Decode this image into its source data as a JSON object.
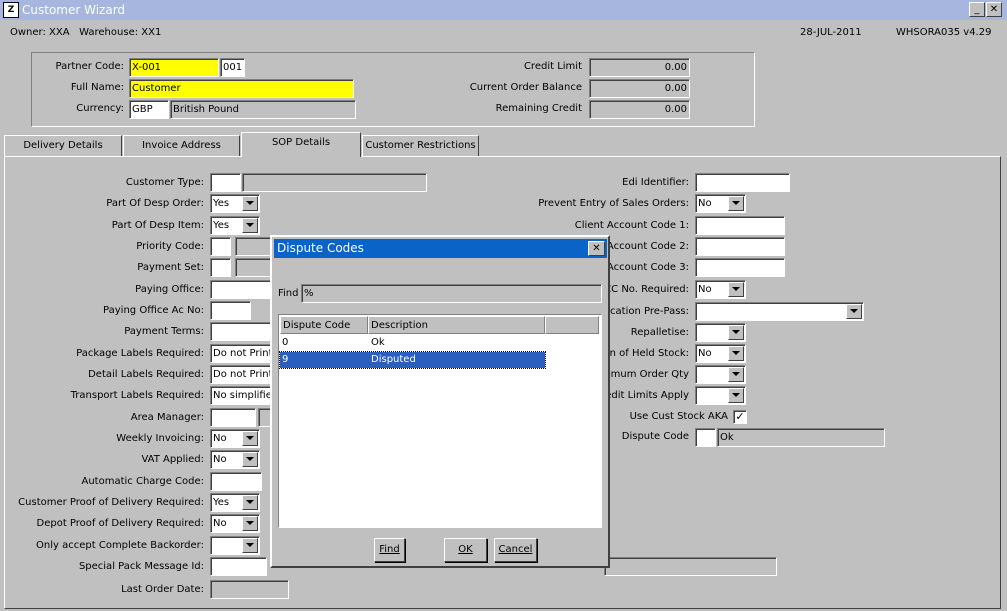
{
  "window": {
    "title": "Customer Wizard",
    "icon_text": "Z"
  },
  "header": {
    "owner_label": "Owner:",
    "owner_value": "XXA",
    "warehouse_label": "Warehouse:",
    "warehouse_value": "XX1",
    "date": "28-JUL-2011",
    "version": "WHSORA035  v4.29"
  },
  "partner": {
    "partner_code_label": "Partner Code:",
    "partner_code": "X-001",
    "partner_code_suffix": "001",
    "full_name_label": "Full Name:",
    "full_name": "Customer",
    "currency_label": "Currency:",
    "currency_code": "GBP",
    "currency_name": "British Pound",
    "credit_limit_label": "Credit Limit",
    "credit_limit": "0.00",
    "order_balance_label": "Current Order Balance",
    "order_balance": "0.00",
    "remaining_credit_label": "Remaining Credit",
    "remaining_credit": "0.00"
  },
  "tabs": [
    {
      "label": "Delivery Details"
    },
    {
      "label": "Invoice Address"
    },
    {
      "label": "SOP Details"
    },
    {
      "label": "Customer Restrictions"
    }
  ],
  "left_fields": {
    "customer_type": {
      "label": "Customer Type:",
      "value": "",
      "desc": ""
    },
    "part_desp_order": {
      "label": "Part Of Desp Order:",
      "value": "Yes"
    },
    "part_desp_item": {
      "label": "Part Of Desp Item:",
      "value": "Yes"
    },
    "priority_code": {
      "label": "Priority Code:",
      "value": ""
    },
    "payment_set": {
      "label": "Payment Set:",
      "value": ""
    },
    "paying_office": {
      "label": "Paying Office:",
      "value": ""
    },
    "paying_office_ac": {
      "label": "Paying Office Ac No:",
      "value": ""
    },
    "payment_terms": {
      "label": "Payment Terms:",
      "value": ""
    },
    "package_labels": {
      "label": "Package Labels Required:",
      "value": "Do not Print"
    },
    "detail_labels": {
      "label": "Detail Labels Required:",
      "value": "Do not Print"
    },
    "transport_labels": {
      "label": "Transport Labels Required:",
      "value": "No simplified"
    },
    "area_manager": {
      "label": "Area Manager:",
      "value": ""
    },
    "weekly_invoicing": {
      "label": "Weekly Invoicing:",
      "value": "No"
    },
    "vat_applied": {
      "label": "VAT Applied:",
      "value": "No"
    },
    "auto_charge": {
      "label": "Automatic Charge Code:",
      "value": ""
    },
    "cust_pod": {
      "label": "Customer Proof of Delivery Required:",
      "value": "Yes"
    },
    "depot_pod": {
      "label": "Depot Proof of Delivery Required:",
      "value": "No"
    },
    "complete_backorder": {
      "label": "Only accept Complete Backorder:",
      "value": ""
    },
    "special_pack": {
      "label": "Special Pack Message Id:",
      "value": ""
    },
    "last_order_date": {
      "label": "Last Order Date:",
      "value": ""
    }
  },
  "right_fields": {
    "edi_identifier": {
      "label": "Edi Identifier:",
      "value": ""
    },
    "prevent_sales": {
      "label": "Prevent Entry of Sales Orders:",
      "value": "No"
    },
    "client_ac1": {
      "label": "Client Account Code 1:",
      "value": ""
    },
    "client_ac2": {
      "label": "Account Code 2:",
      "value": ""
    },
    "client_ac3": {
      "label": "Account Code 3:",
      "value": ""
    },
    "cc_required": {
      "label": "CC No. Required:",
      "value": "No"
    },
    "alloc_prepass": {
      "label": "cation Pre-Pass:",
      "value": ""
    },
    "repalletise": {
      "label": "Repalletise:",
      "value": ""
    },
    "held_stock": {
      "label": "on of Held Stock:",
      "value": "No"
    },
    "max_order_qty": {
      "label": "ximum Order Qty",
      "value": ""
    },
    "credit_limits": {
      "label": "edit Limits Apply",
      "value": ""
    },
    "use_cust_stock": {
      "label": "Use Cust Stock AKA",
      "checked": "✓"
    },
    "dispute_code": {
      "label": "Dispute Code",
      "value": "",
      "desc": "Ok"
    }
  },
  "dialog": {
    "title": "Dispute Codes",
    "find_label": "Find",
    "find_value": "%",
    "columns": [
      "Dispute Code",
      "Description"
    ],
    "rows": [
      {
        "code": "0",
        "desc": "Ok"
      },
      {
        "code": "9",
        "desc": "Disputed"
      }
    ],
    "find_button": "Find",
    "ok_button": "OK",
    "cancel_button": "Cancel"
  },
  "colors": {
    "title_bar": "#a6b6de",
    "dialog_title": "#0a64c8",
    "highlight": "#ffff00",
    "selection": "#2a5fc0"
  }
}
